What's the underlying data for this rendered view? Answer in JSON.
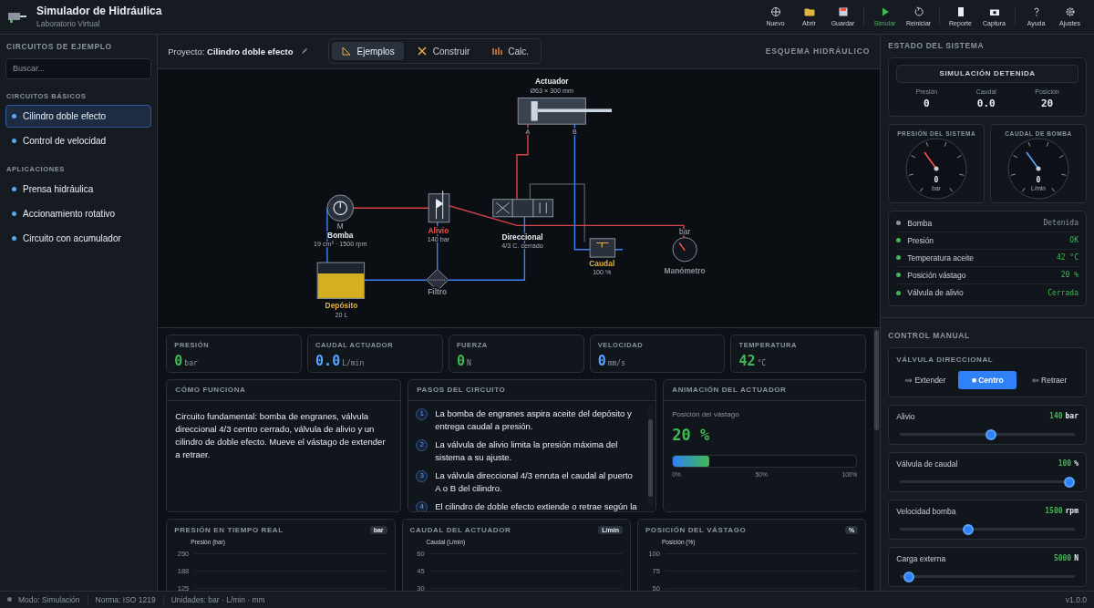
{
  "app": {
    "title": "Simulador de Hidráulica",
    "subtitle": "Laboratorio Virtual"
  },
  "toolbar_groups": [
    [
      {
        "label": "Nuevo",
        "kind": "new"
      },
      {
        "label": "Abrir",
        "kind": "open"
      },
      {
        "label": "Guardar",
        "kind": "save"
      }
    ],
    [
      {
        "label": "Simular",
        "kind": "play"
      },
      {
        "label": "Reiniciar",
        "kind": "reset"
      }
    ],
    [
      {
        "label": "Reporte",
        "kind": "report"
      },
      {
        "label": "Captura",
        "kind": "camera"
      }
    ],
    [
      {
        "label": "Ayuda",
        "kind": "help"
      },
      {
        "label": "Ajustes",
        "kind": "settings"
      }
    ]
  ],
  "sidebar": {
    "title": "CIRCUITOS DE EJEMPLO",
    "search": {
      "placeholder": "Buscar..."
    },
    "sections": [
      {
        "title": "CIRCUITOS BÁSICOS",
        "items": [
          {
            "label": "Cilindro doble efecto",
            "selected": true
          },
          {
            "label": "Control de velocidad",
            "selected": false
          }
        ]
      },
      {
        "title": "APLICACIONES",
        "items": [
          {
            "label": "Prensa hidráulica",
            "selected": false
          },
          {
            "label": "Accionamiento rotativo",
            "selected": false
          },
          {
            "label": "Circuito con acumulador",
            "selected": false
          }
        ]
      }
    ]
  },
  "project": {
    "label": "Proyecto:",
    "name": "Cilindro doble efecto",
    "tabs": [
      {
        "label": "Ejemplos",
        "kind": "ruler",
        "selected": true
      },
      {
        "label": "Construir",
        "kind": "tools",
        "selected": false
      },
      {
        "label": "Calc.",
        "kind": "bars",
        "selected": false
      }
    ],
    "caption": "ESQUEMA HIDRÁULICO"
  },
  "diagram": {
    "components": [
      {
        "kind": "cylinder",
        "label": "Actuador",
        "detail": "Ø63 × 300 mm",
        "color": "#e6edf3",
        "ports": [
          "A",
          "B"
        ]
      },
      {
        "kind": "pump",
        "label": "Bomba",
        "detail": "19 cm³ · 1500 rpm",
        "color": "#e6edf3",
        "tag": "M"
      },
      {
        "kind": "relief",
        "label": "Alivio",
        "detail": "140 bar",
        "color": "#f85149"
      },
      {
        "kind": "valve",
        "label": "Direccional",
        "detail": "4/3 C. cerrado",
        "color": "#e6edf3"
      },
      {
        "kind": "flow",
        "label": "Caudal",
        "detail": "100 %",
        "color": "#e3b341"
      },
      {
        "kind": "gauge",
        "label": "Manómetro",
        "color": "#8b949e",
        "tag": "bar"
      },
      {
        "kind": "tank",
        "label": "Depósito",
        "detail": "20 L",
        "color": "#e3b341"
      },
      {
        "kind": "filter",
        "label": "Filtro",
        "color": "#8b949e"
      }
    ]
  },
  "metrics": [
    {
      "label": "PRESIÓN",
      "value": "0",
      "unit": "bar",
      "color": "#3fb950"
    },
    {
      "label": "CAUDAL ACTUADOR",
      "value": "0.0",
      "unit": "L/min",
      "color": "#58a6ff"
    },
    {
      "label": "FUERZA",
      "value": "0",
      "unit": "N",
      "color": "#3fb950"
    },
    {
      "label": "VELOCIDAD",
      "value": "0",
      "unit": "mm/s",
      "color": "#58a6ff"
    },
    {
      "label": "TEMPERATURA",
      "value": "42",
      "unit": "°C",
      "color": "#3fb950"
    }
  ],
  "how": {
    "title": "CÓMO FUNCIONA",
    "text": "Circuito fundamental: bomba de engranes, válvula direccional 4/3 centro cerrado, válvula de alivio y un cilindro de doble efecto. Mueve el vástago de extender a retraer."
  },
  "steps": {
    "title": "PASOS DEL CIRCUITO",
    "items": [
      {
        "number": "1",
        "text": "La bomba de engranes aspira aceite del depósito y entrega caudal a presión."
      },
      {
        "number": "2",
        "text": "La válvula de alivio limita la presión máxima del sistema a su ajuste."
      },
      {
        "number": "3",
        "text": "La válvula direccional 4/3 enruta el caudal al puerto A o B del cilindro."
      },
      {
        "number": "4",
        "text": "El cilindro de doble efecto extiende o retrae según la"
      }
    ]
  },
  "animation": {
    "title": "ANIMACIÓN DEL ACTUADOR",
    "label": "Posición del vástago",
    "value": "20 %",
    "level": 0.2,
    "scale": [
      "0%",
      "50%",
      "100%"
    ]
  },
  "charts": [
    {
      "title": "PRESIÓN EN TIEMPO REAL",
      "unit": "bar",
      "series_label": "Presión (bar)",
      "ticks": [
        "250",
        "188",
        "125"
      ]
    },
    {
      "title": "CAUDAL DEL ACTUADOR",
      "unit": "L/min",
      "series_label": "Caudal (L/min)",
      "ticks": [
        "60",
        "45",
        "30"
      ]
    },
    {
      "title": "POSICIÓN DEL VÁSTAGO",
      "unit": "%",
      "series_label": "Posición (%)",
      "ticks": [
        "100",
        "75",
        "50"
      ]
    }
  ],
  "state": {
    "title": "ESTADO DEL SISTEMA",
    "banner": "SIMULACIÓN DETENIDA",
    "readouts": [
      {
        "label": "Presión",
        "value": "0"
      },
      {
        "label": "Caudal",
        "value": "0.0"
      },
      {
        "label": "Posición",
        "value": "20"
      }
    ],
    "gauges": [
      {
        "title": "PRESIÓN DEL SISTEMA",
        "value": "0",
        "unit": "bar",
        "color": "#f85149"
      },
      {
        "title": "CAUDAL DE BOMBA",
        "value": "0",
        "unit": "L/min",
        "color": "#58a6ff"
      }
    ],
    "items": [
      {
        "label": "Bomba",
        "value": "Detenida",
        "color": "#8b949e"
      },
      {
        "label": "Presión",
        "value": "OK",
        "color": "#3fb950"
      },
      {
        "label": "Temperatura aceite",
        "value": "42 °C",
        "color": "#3fb950"
      },
      {
        "label": "Posición vástago",
        "value": "20 %",
        "color": "#3fb950"
      },
      {
        "label": "Válvula de alivio",
        "value": "Cerrada",
        "color": "#3fb950"
      }
    ]
  },
  "control": {
    "title": "CONTROL MANUAL",
    "valve": {
      "title": "VÁLVULA DIRECCIONAL",
      "options": [
        {
          "label": "⇨ Extender",
          "selected": false
        },
        {
          "label": "■ Centro",
          "selected": true
        },
        {
          "label": "⇦ Retraer",
          "selected": false
        }
      ]
    },
    "sliders": [
      {
        "label": "Alivio",
        "value": "140",
        "unit": "bar",
        "level": 0.52
      },
      {
        "label": "Válvula de caudal",
        "value": "100",
        "unit": "%",
        "level": 1
      },
      {
        "label": "Velocidad bomba",
        "value": "1500",
        "unit": "rpm",
        "level": 0.38
      },
      {
        "label": "Carga externa",
        "value": "5000",
        "unit": "N",
        "level": 0.02
      }
    ]
  },
  "status_bar": {
    "items": [
      "Modo: Simulación",
      "Norma: ISO 1219",
      "Unidades: bar · L/min · mm"
    ],
    "version": "v1.0.0"
  }
}
